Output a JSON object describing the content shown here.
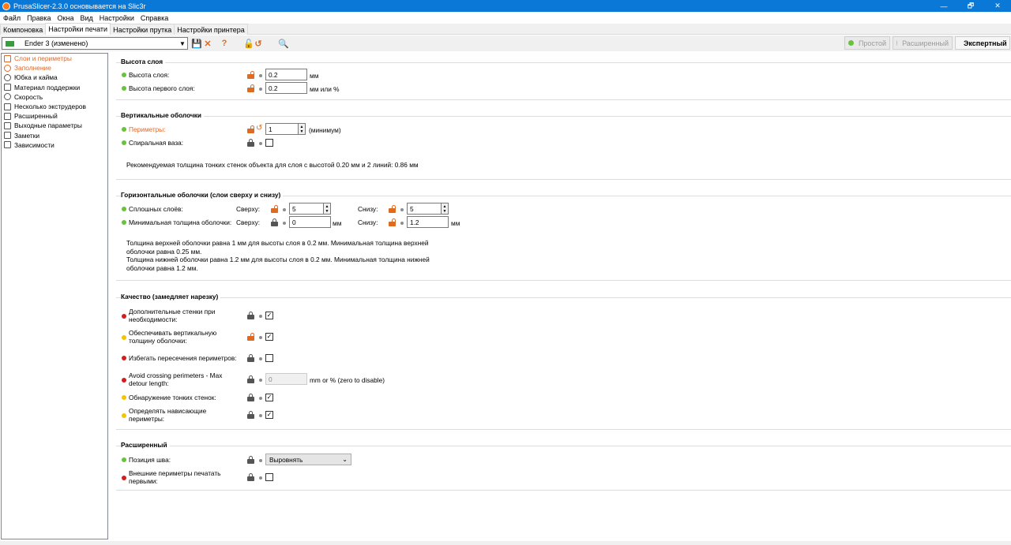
{
  "window": {
    "title": "PrusaSlicer-2.3.0 основывается на Slic3r",
    "minimize": "—",
    "maximize": "🗗",
    "close": "✕"
  },
  "menu": [
    "Файл",
    "Правка",
    "Окна",
    "Вид",
    "Настройки",
    "Справка"
  ],
  "tabs": [
    "Компоновка",
    "Настройки печати",
    "Настройки прутка",
    "Настройки принтера"
  ],
  "toolbar": {
    "preset": "Ender 3 (изменено)",
    "save_icon": "💾",
    "delete_icon": "✕",
    "help_icon": "?",
    "lock_icon": "🔓",
    "undo_icon": "↺",
    "search_icon": "🔍"
  },
  "modes": [
    {
      "label": "Простой",
      "color": "#68c33a"
    },
    {
      "label": "Расширенный",
      "color": "#f5c400"
    },
    {
      "label": "Экспертный",
      "color": "#cf1f1f"
    }
  ],
  "sidebar": [
    "Слои и периметры",
    "Заполнение",
    "Юбка и кайма",
    "Материал поддержки",
    "Скорость",
    "Несколько экструдеров",
    "Расширенный",
    "Выходные параметры",
    "Заметки",
    "Зависимости"
  ],
  "layer_height": {
    "title": "Высота слоя",
    "layer_height_label": "Высота слоя:",
    "layer_height_value": "0.2",
    "layer_height_unit": "мм",
    "first_layer_label": "Высота первого слоя:",
    "first_layer_value": "0.2",
    "first_layer_unit": "мм или %"
  },
  "vertical": {
    "title": "Вертикальные оболочки",
    "perimeters_label": "Периметры:",
    "perimeters_value": "1",
    "perimeters_unit": "(минимум)",
    "spiral_label": "Спиральная ваза:",
    "note": "Рекомендуемая толщина тонких стенок объекта для слоя с высотой 0.20 мм и 2 линий: 0.86 мм"
  },
  "horizontal": {
    "title": "Горизонтальные оболочки (слои сверху и снизу)",
    "solid_label": "Сплошных слоёв:",
    "top_label": "Сверху:",
    "bottom_label": "Снизу:",
    "solid_top": "5",
    "solid_bottom": "5",
    "min_label": "Минимальная толщина оболочки:",
    "min_top": "0",
    "min_bottom": "1.2",
    "unit": "мм",
    "note1": "Толщина верхней оболочки равна 1 мм для высоты слоя в 0.2 мм. Минимальная толщина верхней",
    "note2": "оболочки равна 0.25 мм.",
    "note3": "Толщина нижней оболочки равна 1.2 мм для высоты слоя в 0.2 мм. Минимальная толщина нижней",
    "note4": "оболочки равна 1.2 мм."
  },
  "quality": {
    "title": "Качество (замедляет нарезку)",
    "extra_perim_1": "Дополнительные стенки при",
    "extra_perim_2": "необходимости:",
    "ensure_vert_1": "Обеспечивать вертикальную",
    "ensure_vert_2": "толщину оболочки:",
    "avoid_crossing": "Избегать пересечения периметров:",
    "avoid_detour_1": "Avoid crossing perimeters - Max",
    "avoid_detour_2": "detour length:",
    "avoid_detour_value": "0",
    "avoid_detour_unit": "mm or % (zero to disable)",
    "thin_walls": "Обнаружение тонких стенок:",
    "overhangs_1": "Определять нависающие",
    "overhangs_2": "периметры:",
    "check": "✓"
  },
  "advanced": {
    "title": "Расширенный",
    "seam_label": "Позиция шва:",
    "seam_value": "Выровнять",
    "combo_arrow": "⌄",
    "external_first_1": "Внешние периметры печатать",
    "external_first_2": "первыми:"
  },
  "spin_up": "▲",
  "spin_down": "▼",
  "select_arrow": "▼"
}
